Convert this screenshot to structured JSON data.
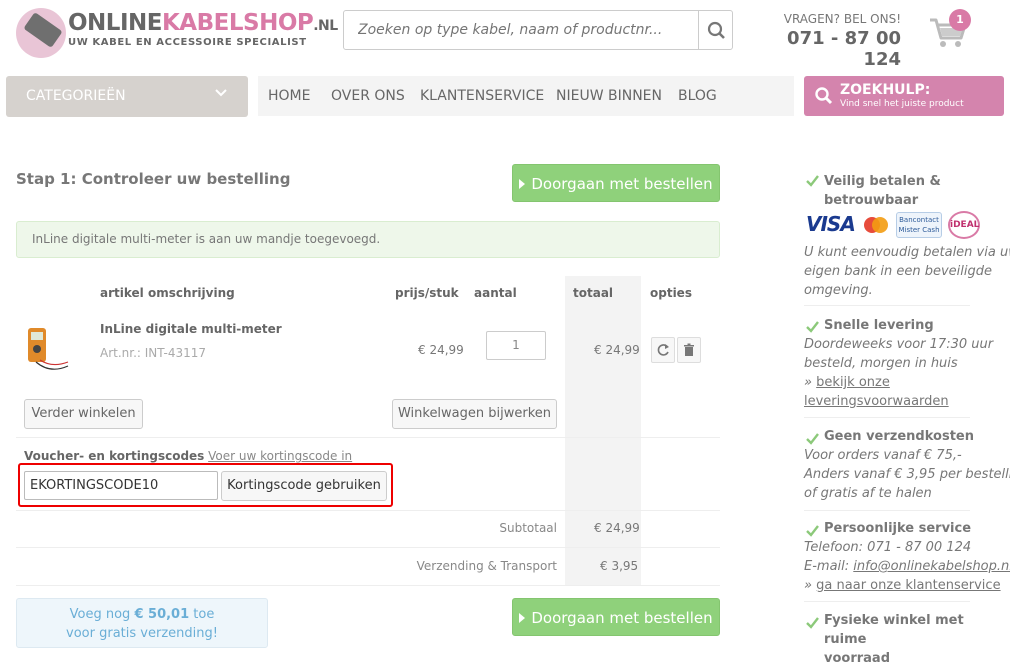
{
  "header": {
    "logo_main": "ONLINE",
    "logo_accent": "KABELSHOP",
    "logo_suffix": ".NL",
    "logo_tagline": "UW KABEL EN ACCESSOIRE SPECIALIST",
    "search_placeholder": "Zoeken op type kabel, naam of productnr...",
    "phone_label": "VRAGEN? BEL ONS!",
    "phone_number": "071 - 87 00 124",
    "cart_count": "1"
  },
  "nav": {
    "categories_label": "CATEGORIEËN",
    "items": [
      "HOME",
      "OVER ONS",
      "KLANTENSERVICE",
      "NIEUW BINNEN",
      "BLOG"
    ],
    "help_title": "ZOEKHULP:",
    "help_subtitle": "Vind snel het juiste product"
  },
  "main": {
    "step_title": "Stap 1: Controleer uw bestelling",
    "continue_label": "Doorgaan met bestellen",
    "alert_text": "InLine digitale multi-meter is aan uw mandje toegevoegd.",
    "columns": {
      "description": "artikel omschrijving",
      "price": "prijs/stuk",
      "quantity": "aantal",
      "total": "totaal",
      "options": "opties"
    },
    "item": {
      "name": "InLine digitale multi-meter",
      "article_no": "Art.nr.: INT-43117",
      "price": "€ 24,99",
      "quantity": "1",
      "total": "€ 24,99"
    },
    "continue_shopping": "Verder winkelen",
    "update_cart": "Winkelwagen bijwerken",
    "voucher_label": "Voucher- en kortingscodes",
    "voucher_link": "Voer uw kortingscode in",
    "voucher_value": "EKORTINGSCODE10",
    "voucher_button": "Kortingscode gebruiken",
    "subtotal_label": "Subtotaal",
    "subtotal_value": "€ 24,99",
    "shipping_label": "Verzending & Transport",
    "shipping_value": "€ 3,95",
    "free_shipping_pre": "Voeg nog",
    "free_shipping_amount": "€ 50,01",
    "free_shipping_post": "toe",
    "free_shipping_line2": "voor gratis verzending!"
  },
  "sidebar": {
    "pay_title_1": "Veilig betalen &",
    "pay_title_2": "betrouwbaar",
    "payment_logos": [
      "VISA",
      "Mastercard",
      "Bancontact Mister Cash",
      "iDEAL"
    ],
    "pay_text": [
      "U kunt eenvoudig betalen via uw",
      "eigen bank in een beveiligde",
      "omgeving."
    ],
    "delivery_title": "Snelle levering",
    "delivery_text": [
      "Doordeweeks voor 17:30 uur",
      "besteld, morgen in huis"
    ],
    "delivery_link_pre": "»",
    "delivery_link_1": "bekijk onze",
    "delivery_link_2": "leveringsvoorwaarden",
    "shipping_title": "Geen verzendkosten",
    "shipping_text": [
      "Voor orders vanaf € 75,-",
      "Anders vanaf € 3,95 per bestelling,",
      "of gratis af te halen"
    ],
    "service_title": "Persoonlijke service",
    "service_phone": "Telefoon: 071 - 87 00 124",
    "service_email_label": "E-mail:",
    "service_email": "info@onlinekabelshop.nl",
    "service_link_pre": "»",
    "service_link": "ga naar onze klantenservice",
    "store_title_1": "Fysieke winkel met ruime",
    "store_title_2": "voorraad"
  },
  "colors": {
    "brand_pink": "#d97aa6",
    "green_button": "#8fd17b",
    "check_green": "#8cc97a",
    "highlight_red": "#e00000"
  }
}
